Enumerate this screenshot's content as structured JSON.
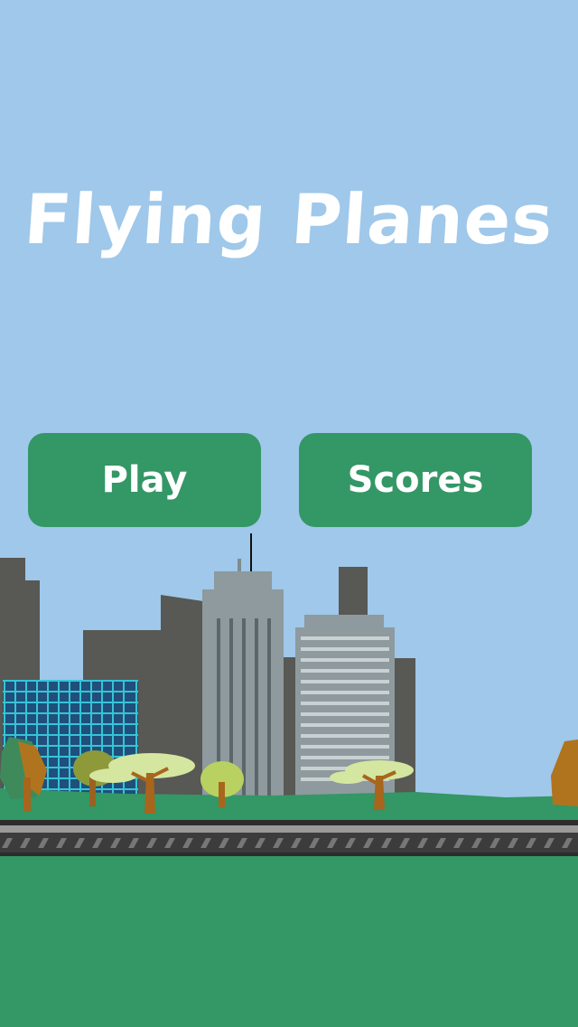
{
  "title": "Flying Planes",
  "buttons": {
    "play": "Play",
    "scores": "Scores"
  },
  "colors": {
    "sky": "#9fc8ea",
    "grass": "#339766",
    "button": "#339766",
    "building_dark": "#5a5a56",
    "building_gray": "#8c989c",
    "track": "#3c3c3c"
  }
}
